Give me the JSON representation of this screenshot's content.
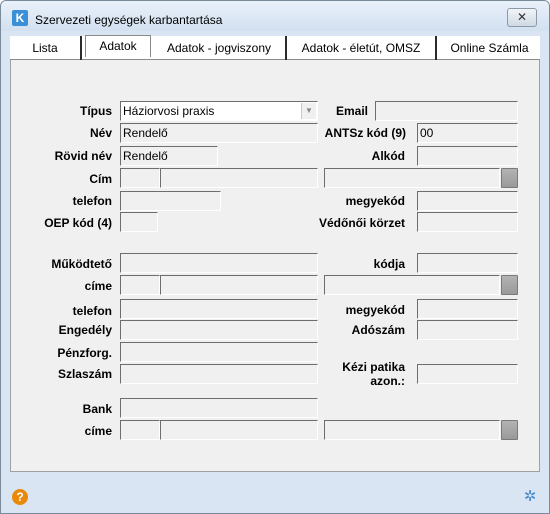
{
  "window": {
    "title": "Szervezeti egységek karbantartása",
    "app_icon_glyph": "K",
    "close_glyph": "✕",
    "icon_names": [
      "app-icon",
      "close-icon",
      "help-icon",
      "settings-icon"
    ]
  },
  "tabs": [
    {
      "label": "Lista"
    },
    {
      "label": "Adatok",
      "active": true
    },
    {
      "label": "Adatok - jogviszony"
    },
    {
      "label": "Adatok - életút, OMSZ"
    },
    {
      "label": "Online Számla"
    }
  ],
  "form": {
    "tipus": {
      "label": "Típus",
      "value": "Háziorvosi praxis",
      "arrow": "▼"
    },
    "email": {
      "label": "Email",
      "value": ""
    },
    "nev": {
      "label": "Név",
      "value": "Rendelő"
    },
    "antsz": {
      "label": "ANTSz kód (9)",
      "value": "00"
    },
    "rovid_nev": {
      "label": "Rövid név",
      "value": "Rendelő"
    },
    "alkod": {
      "label": "Alkód",
      "value": ""
    },
    "cim": {
      "label": "Cím"
    },
    "telefon": {
      "label": "telefon",
      "value": ""
    },
    "megyekod": {
      "label": "megyekód",
      "value": ""
    },
    "oep_kod": {
      "label": "OEP kód (4)",
      "value": ""
    },
    "vedonoi_korzet": {
      "label": "Védőnői körzet",
      "value": ""
    },
    "mukodteto": {
      "label": "Működtető",
      "value": ""
    },
    "kodja": {
      "label": "kódja",
      "value": ""
    },
    "mukodteto_cime": {
      "label": "címe"
    },
    "mukodteto_telefon": {
      "label": "telefon",
      "value": ""
    },
    "mukodteto_megyekod": {
      "label": "megyekód",
      "value": ""
    },
    "engedely": {
      "label": "Engedély",
      "value": ""
    },
    "adoszam": {
      "label": "Adószám",
      "value": ""
    },
    "penzforg": {
      "label": "Pénzforg.",
      "value": ""
    },
    "szlaszam": {
      "label": "Szlaszám",
      "value": ""
    },
    "kezi_patika": {
      "label_line1": "Kézi patika",
      "label_line2": "azon.:",
      "value": ""
    },
    "bank": {
      "label": "Bank",
      "value": ""
    },
    "bank_cime": {
      "label": "címe"
    }
  },
  "footer": {
    "help_glyph": "?",
    "settings_glyph": "✲"
  }
}
